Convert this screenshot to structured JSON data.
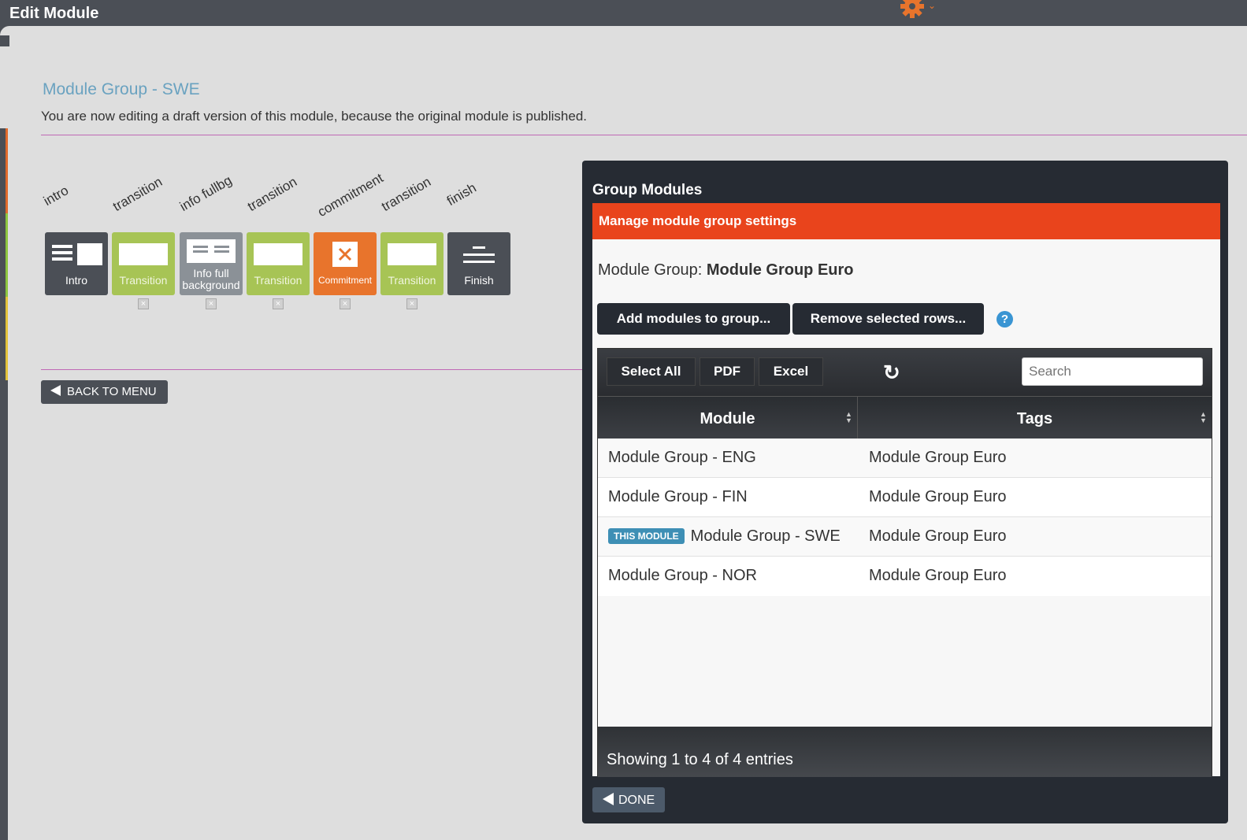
{
  "header": {
    "title": "Edit Module"
  },
  "page": {
    "module_title": "Module Group - SWE",
    "draft_note": "You are now editing a draft version of this module, because the original module is published."
  },
  "slides": [
    {
      "type_label": "intro",
      "caption": "Intro",
      "style": "dark",
      "icon": "intro-layout-icon",
      "deletable": false
    },
    {
      "type_label": "transition",
      "caption": "Transition",
      "style": "green",
      "icon": "transition-layout-icon",
      "deletable": true
    },
    {
      "type_label": "info fullbg",
      "caption": "Info full background",
      "style": "grey",
      "icon": "info-layout-icon",
      "deletable": true
    },
    {
      "type_label": "transition",
      "caption": "Transition",
      "style": "green",
      "icon": "transition-layout-icon",
      "deletable": true
    },
    {
      "type_label": "commitment",
      "caption": "Commitment",
      "style": "orange",
      "icon": "commitment-x-icon",
      "deletable": true
    },
    {
      "type_label": "transition",
      "caption": "Transition",
      "style": "green",
      "icon": "transition-layout-icon",
      "deletable": true
    },
    {
      "type_label": "finish",
      "caption": "Finish",
      "style": "dark",
      "icon": "finish-lines-icon",
      "deletable": false
    }
  ],
  "back_button": "BACK TO MENU",
  "dialog": {
    "title": "Group Modules",
    "banner": "Manage module group settings",
    "group_label": "Module Group: ",
    "group_name": "Module Group Euro",
    "add_button": "Add modules to group...",
    "remove_button": "Remove selected rows...",
    "help_glyph": "?",
    "toolbar": {
      "select_all": "Select All",
      "pdf": "PDF",
      "excel": "Excel",
      "search_placeholder": "Search"
    },
    "columns": [
      "Module",
      "Tags"
    ],
    "rows": [
      {
        "module": "Module Group - ENG",
        "tags": "Module Group Euro",
        "badge": ""
      },
      {
        "module": "Module Group - FIN",
        "tags": "Module Group Euro",
        "badge": ""
      },
      {
        "module": "Module Group - SWE",
        "tags": "Module Group Euro",
        "badge": "THIS MODULE"
      },
      {
        "module": "Module Group - NOR",
        "tags": "Module Group Euro",
        "badge": ""
      }
    ],
    "footer": "Showing 1 to 4 of 4 entries",
    "done_button": "DONE"
  },
  "colors": {
    "accent_orange": "#e9441c",
    "transition_green": "#a7c455",
    "title_blue": "#6aa2c0",
    "badge_blue": "#3e8fb5",
    "divider_magenta": "#c069b5"
  }
}
